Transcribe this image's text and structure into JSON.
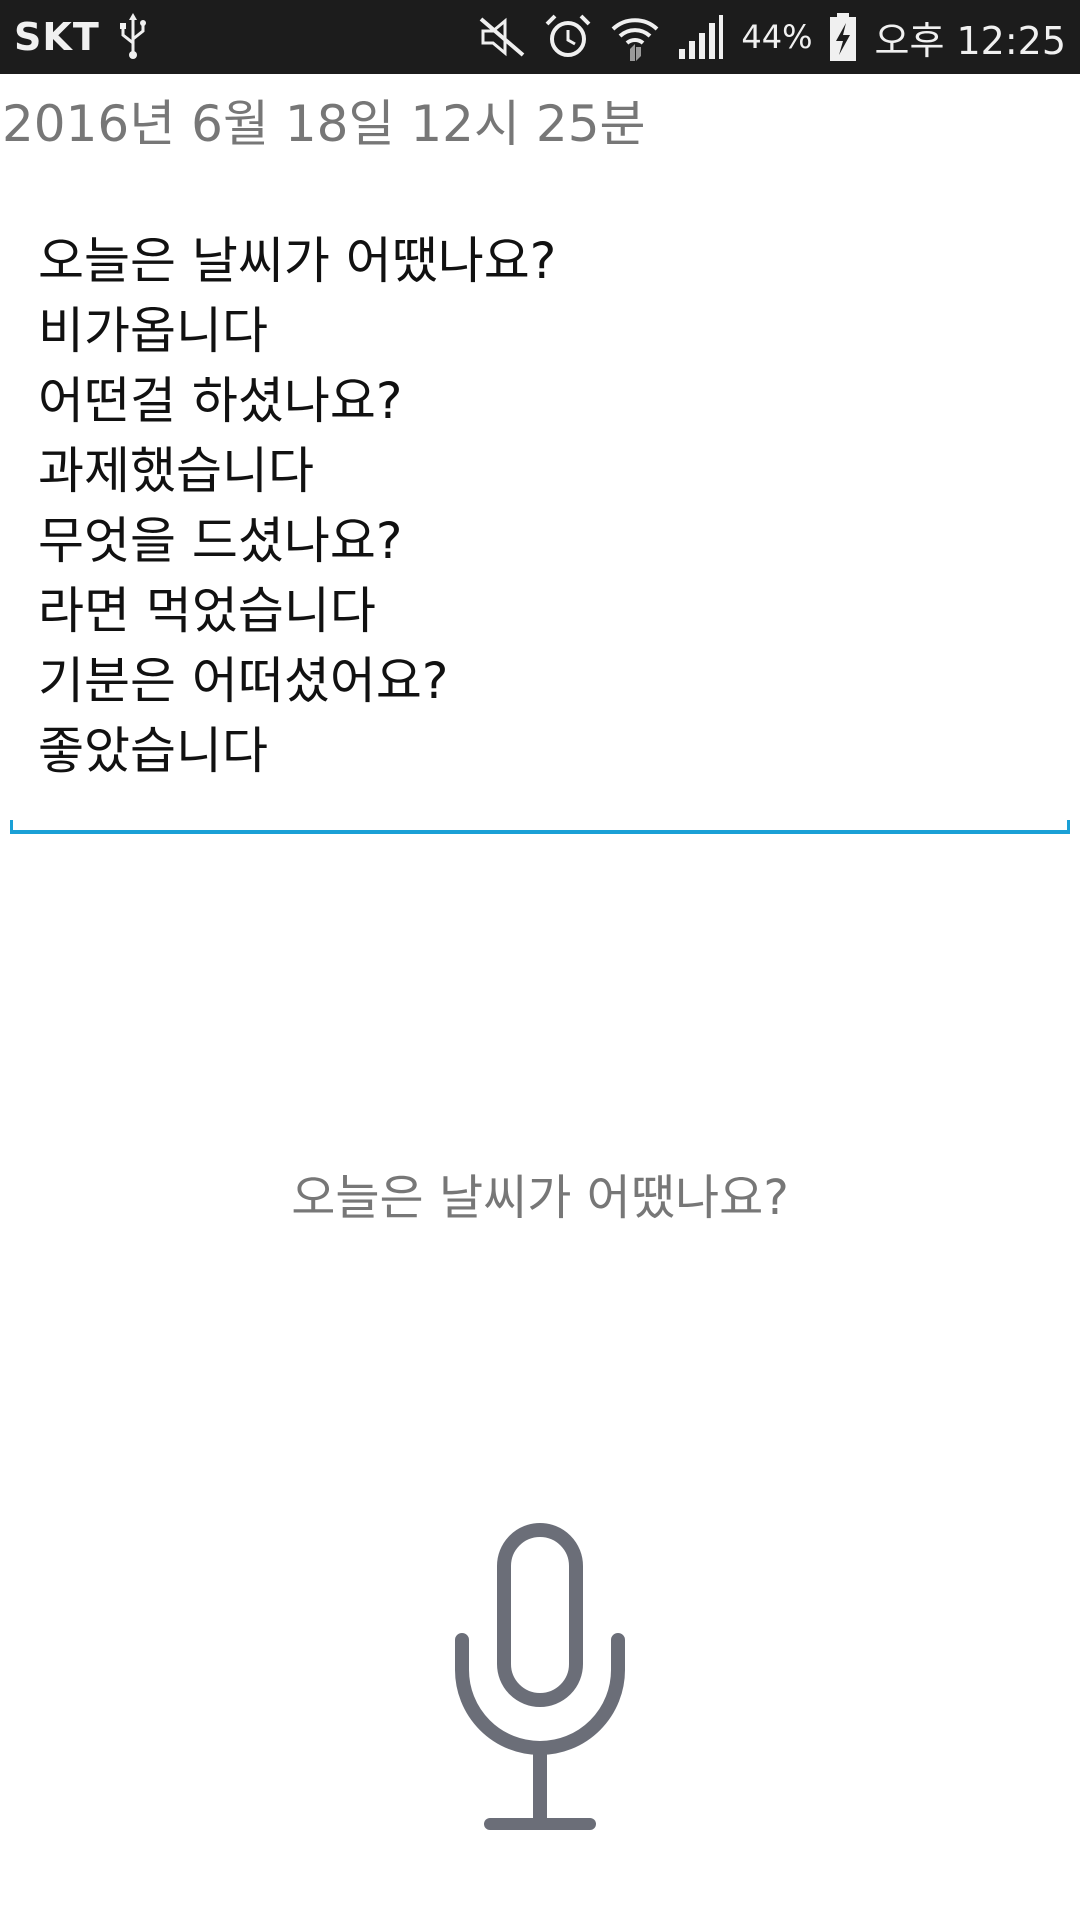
{
  "status_bar": {
    "carrier": "SKT",
    "battery_percent": "44%",
    "time": "오후 12:25",
    "icons": [
      "usb-icon",
      "mute-icon",
      "alarm-icon",
      "wifi-icon",
      "signal-icon",
      "battery-charging-icon"
    ]
  },
  "diary": {
    "date": "2016년 6월 18일 12시 25분",
    "lines": [
      "오늘은 날씨가 어땠나요?",
      "비가옵니다",
      "어떤걸 하셨나요?",
      "과제했습니다",
      "무엇을 드셨나요?",
      "라면 먹었습니다",
      "기분은 어떠셨어요?",
      "좋았습니다"
    ]
  },
  "prompt": {
    "question": "오늘은 날씨가 어땠나요?"
  },
  "mic": {
    "icon": "microphone-icon"
  },
  "colors": {
    "status_bar_bg": "#1c1c1c",
    "accent": "#1aa0d6",
    "mic": "#6b6e78",
    "muted_text": "#777777"
  }
}
